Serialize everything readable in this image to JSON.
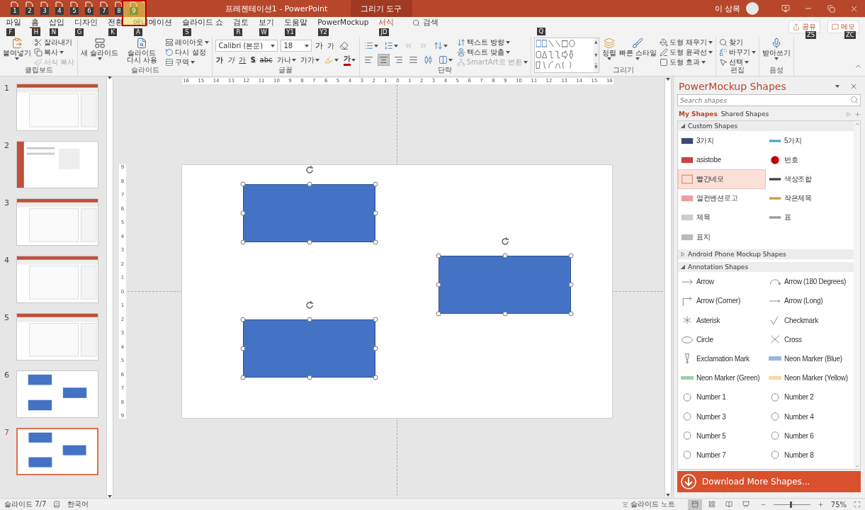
{
  "title_bar": {
    "quick_access": [
      {
        "keytip": "1",
        "highlighted": false
      },
      {
        "keytip": "2",
        "highlighted": false
      },
      {
        "keytip": "3",
        "highlighted": false
      },
      {
        "keytip": "4",
        "highlighted": false
      },
      {
        "keytip": "5",
        "highlighted": false
      },
      {
        "keytip": "6",
        "highlighted": false
      },
      {
        "keytip": "7",
        "highlighted": false
      },
      {
        "keytip": "8",
        "highlighted": false
      },
      {
        "keytip": "9",
        "highlighted": true
      }
    ],
    "title": "프레젠테이션1  -  PowerPoint",
    "context_tab": "그리기 도구",
    "user": "이 상목"
  },
  "tabs": [
    {
      "label": "파일",
      "keytip": "F",
      "selected": false,
      "contextual": false
    },
    {
      "label": "홈",
      "keytip": "H",
      "selected": true,
      "contextual": false
    },
    {
      "label": "삽입",
      "keytip": "N",
      "selected": false,
      "contextual": false
    },
    {
      "label": "디자인",
      "keytip": "G",
      "selected": false,
      "contextual": false
    },
    {
      "label": "전환",
      "keytip": "K",
      "selected": false,
      "contextual": false
    },
    {
      "label": "애니메이션",
      "keytip": "A",
      "selected": false,
      "contextual": false
    },
    {
      "label": "슬라이드 쇼",
      "keytip": "S",
      "selected": false,
      "contextual": false
    },
    {
      "label": "검토",
      "keytip": "R",
      "selected": false,
      "contextual": false
    },
    {
      "label": "보기",
      "keytip": "W",
      "selected": false,
      "contextual": false
    },
    {
      "label": "도움말",
      "keytip": "Y1",
      "selected": false,
      "contextual": false
    },
    {
      "label": "PowerMockup",
      "keytip": "Y2",
      "selected": false,
      "contextual": false
    },
    {
      "label": "서식",
      "keytip": "JD",
      "selected": false,
      "contextual": true
    }
  ],
  "tell_me": {
    "label": "검색"
  },
  "share_buttons": [
    {
      "label": "공유",
      "keytip": "ZS"
    },
    {
      "label": "메모",
      "keytip": "ZC"
    }
  ],
  "ribbon": {
    "groups": [
      {
        "title": "클립보드",
        "columns": [
          [
            {
              "kind": "large",
              "label": "붙여넣기",
              "menu": true
            }
          ],
          [
            {
              "kind": "small",
              "label": "잘라내기",
              "menu": false,
              "disabled": false
            },
            {
              "kind": "small",
              "label": "복사",
              "menu": true,
              "disabled": false
            },
            {
              "kind": "small",
              "label": "서식 복사",
              "menu": false,
              "disabled": true
            }
          ]
        ]
      },
      {
        "title": "슬라이드",
        "columns": [
          [
            {
              "kind": "large",
              "label": "새 슬라이드",
              "menu": true
            }
          ],
          [
            {
              "kind": "large",
              "label": "슬라이드 다시 사용",
              "menu": false
            }
          ],
          [
            {
              "kind": "small",
              "label": "레이아웃",
              "menu": true,
              "disabled": false
            },
            {
              "kind": "small",
              "label": "다시 설정",
              "menu": false,
              "disabled": false
            },
            {
              "kind": "small",
              "label": "구역",
              "menu": true,
              "disabled": false
            }
          ]
        ]
      },
      {
        "title": "글꼴",
        "columns": [
          [
            {
              "kind": "row",
              "items": [
                {
                  "kind": "combo",
                  "value": "Calibri (본문)",
                  "menu": true
                },
                {
                  "kind": "combo",
                  "value": "18",
                  "menu": true
                },
                {
                  "kind": "glyph",
                  "label": "가",
                  "menu": false
                },
                {
                  "kind": "glyph",
                  "label": "가",
                  "menu": false
                },
                {
                  "kind": "icon",
                  "selected": false,
                  "menu": false
                }
              ]
            },
            {
              "kind": "row",
              "items": [
                {
                  "kind": "glyph",
                  "label": "가",
                  "menu": false
                },
                {
                  "kind": "glyph",
                  "label": "가",
                  "menu": false
                },
                {
                  "kind": "glyph",
                  "label": "가",
                  "menu": false
                },
                {
                  "kind": "glyph",
                  "label": "S",
                  "menu": false
                },
                {
                  "kind": "glyph",
                  "label": "abc",
                  "menu": false
                },
                {
                  "kind": "glyph",
                  "label": "가나",
                  "menu": true
                },
                {
                  "kind": "glyph",
                  "label": "가가",
                  "menu": true
                },
                {
                  "kind": "icon",
                  "selected": false,
                  "menu": true
                },
                {
                  "kind": "glyph",
                  "label": "가",
                  "menu": true
                }
              ]
            }
          ]
        ]
      },
      {
        "title": "단락",
        "columns": [
          [
            {
              "kind": "row",
              "items": [
                {
                  "kind": "icon",
                  "selected": false,
                  "menu": true
                },
                {
                  "kind": "icon",
                  "selected": false,
                  "menu": true
                },
                {
                  "kind": "icon",
                  "selected": false,
                  "menu": false
                },
                {
                  "kind": "icon",
                  "selected": false,
                  "menu": false
                },
                {
                  "kind": "icon",
                  "selected": false,
                  "menu": true
                }
              ]
            },
            {
              "kind": "row",
              "items": [
                {
                  "kind": "icon",
                  "selected": false,
                  "menu": false
                },
                {
                  "kind": "icon",
                  "selected": true,
                  "menu": false
                },
                {
                  "kind": "icon",
                  "selected": false,
                  "menu": false
                },
                {
                  "kind": "icon",
                  "selected": false,
                  "menu": false
                },
                {
                  "kind": "icon",
                  "selected": false,
                  "menu": false
                },
                {
                  "kind": "icon",
                  "selected": false,
                  "menu": true
                }
              ]
            }
          ],
          [
            {
              "kind": "small",
              "label": "텍스트 방향",
              "menu": true,
              "disabled": false
            },
            {
              "kind": "small",
              "label": "텍스트 맞춤",
              "menu": true,
              "disabled": false
            },
            {
              "kind": "small",
              "label": "SmartArt로 변환",
              "menu": true,
              "disabled": true
            }
          ]
        ]
      },
      {
        "title": "그리기",
        "keytip": "Q",
        "columns": [
          [
            {
              "kind": "gallery"
            }
          ],
          [
            {
              "kind": "large",
              "label": "정렬",
              "menu": true
            }
          ],
          [
            {
              "kind": "large",
              "label": "빠른 스타일",
              "menu": true
            }
          ],
          [
            {
              "kind": "small",
              "label": "도형 채우기",
              "menu": true,
              "disabled": false
            },
            {
              "kind": "small",
              "label": "도형 윤곽선",
              "menu": true,
              "disabled": false
            },
            {
              "kind": "small",
              "label": "도형 효과",
              "menu": true,
              "disabled": false
            }
          ]
        ]
      },
      {
        "title": "편집",
        "columns": [
          [
            {
              "kind": "small",
              "label": "찾기",
              "menu": false,
              "disabled": false
            },
            {
              "kind": "small",
              "label": "바꾸기",
              "menu": true,
              "disabled": false
            },
            {
              "kind": "small",
              "label": "선택",
              "menu": true,
              "disabled": false
            }
          ]
        ]
      },
      {
        "title": "음성",
        "columns": [
          [
            {
              "kind": "large",
              "label": "받아쓰기",
              "menu": true
            }
          ]
        ]
      }
    ]
  },
  "slides": [
    {
      "number": "1",
      "kind": "screenshot",
      "selected": false
    },
    {
      "number": "2",
      "kind": "backstage",
      "selected": false
    },
    {
      "number": "3",
      "kind": "screenshot",
      "selected": false
    },
    {
      "number": "4",
      "kind": "screenshot",
      "selected": false
    },
    {
      "number": "5",
      "kind": "screenshot",
      "selected": false
    },
    {
      "number": "6",
      "kind": "shapes",
      "selected": false
    },
    {
      "number": "7",
      "kind": "shapes",
      "selected": true
    }
  ],
  "rulers": {
    "horizontal": [
      "16",
      "15",
      "14",
      "13",
      "12",
      "11",
      "10",
      "9",
      "8",
      "7",
      "6",
      "5",
      "4",
      "3",
      "2",
      "1",
      "0",
      "1",
      "2",
      "3",
      "4",
      "5",
      "6",
      "7",
      "8",
      "9",
      "10",
      "11",
      "12",
      "13",
      "14",
      "15",
      "16"
    ],
    "vertical": [
      "9",
      "8",
      "7",
      "6",
      "5",
      "4",
      "3",
      "2",
      "1",
      "0",
      "1",
      "2",
      "3",
      "4",
      "5",
      "6",
      "7",
      "8",
      "9"
    ]
  },
  "canvas_shapes": [
    {
      "kind": "rectangle",
      "selected": true
    },
    {
      "kind": "rectangle",
      "selected": true
    },
    {
      "kind": "rectangle",
      "selected": true
    }
  ],
  "shapes_panel": {
    "title": "PowerMockup Shapes",
    "search": {
      "placeholder": "Search shapes"
    },
    "tabs": [
      {
        "label": "My Shapes",
        "selected": true
      },
      {
        "label": "Shared Shapes",
        "selected": false
      }
    ],
    "sections": [
      {
        "title": "Custom Shapes",
        "expanded": true,
        "kind": "custom",
        "items": [
          {
            "label": "3가지",
            "selected": false
          },
          {
            "label": "5가지",
            "selected": false
          },
          {
            "label": "asistobe",
            "selected": false
          },
          {
            "label": "번호",
            "selected": false
          },
          {
            "label": "빨간네모",
            "selected": true
          },
          {
            "label": "색상조합",
            "selected": false
          },
          {
            "label": "열컨벤션로고",
            "selected": false
          },
          {
            "label": "작은제목",
            "selected": false
          },
          {
            "label": "제목",
            "selected": false
          },
          {
            "label": "표",
            "selected": false
          },
          {
            "label": "표지",
            "selected": false
          }
        ]
      },
      {
        "title": "Android Phone Mockup Shapes",
        "expanded": false
      },
      {
        "title": "Annotation Shapes",
        "expanded": true,
        "kind": "annotation",
        "items": [
          {
            "label": "Arrow",
            "selected": false
          },
          {
            "label": "Arrow (180 Degrees)",
            "selected": false
          },
          {
            "label": "Arrow (Corner)",
            "selected": false
          },
          {
            "label": "Arrow (Long)",
            "selected": false
          },
          {
            "label": "Asterisk",
            "selected": false
          },
          {
            "label": "Checkmark",
            "selected": false
          },
          {
            "label": "Circle",
            "selected": false
          },
          {
            "label": "Cross",
            "selected": false
          },
          {
            "label": "Exclamation Mark",
            "selected": false
          },
          {
            "label": "Neon Marker (Blue)",
            "selected": false
          },
          {
            "label": "Neon Marker (Green)",
            "selected": false
          },
          {
            "label": "Neon Marker (Yellow)",
            "selected": false
          },
          {
            "label": "Number 1",
            "selected": false
          },
          {
            "label": "Number 2",
            "selected": false
          },
          {
            "label": "Number 3",
            "selected": false
          },
          {
            "label": "Number 4",
            "selected": false
          },
          {
            "label": "Number 5",
            "selected": false
          },
          {
            "label": "Number 6",
            "selected": false
          },
          {
            "label": "Number 7",
            "selected": false
          },
          {
            "label": "Number 8",
            "selected": false
          }
        ]
      }
    ],
    "download_button": "Download More Shapes..."
  },
  "status_bar": {
    "slide": "슬라이드 7/7",
    "language": "한국어",
    "notes": "슬라이드 노트",
    "views": [
      {
        "selected": true
      },
      {
        "selected": false
      },
      {
        "selected": false
      },
      {
        "selected": false
      }
    ],
    "zoom": {
      "level": 0.47,
      "reading": "75%"
    }
  }
}
